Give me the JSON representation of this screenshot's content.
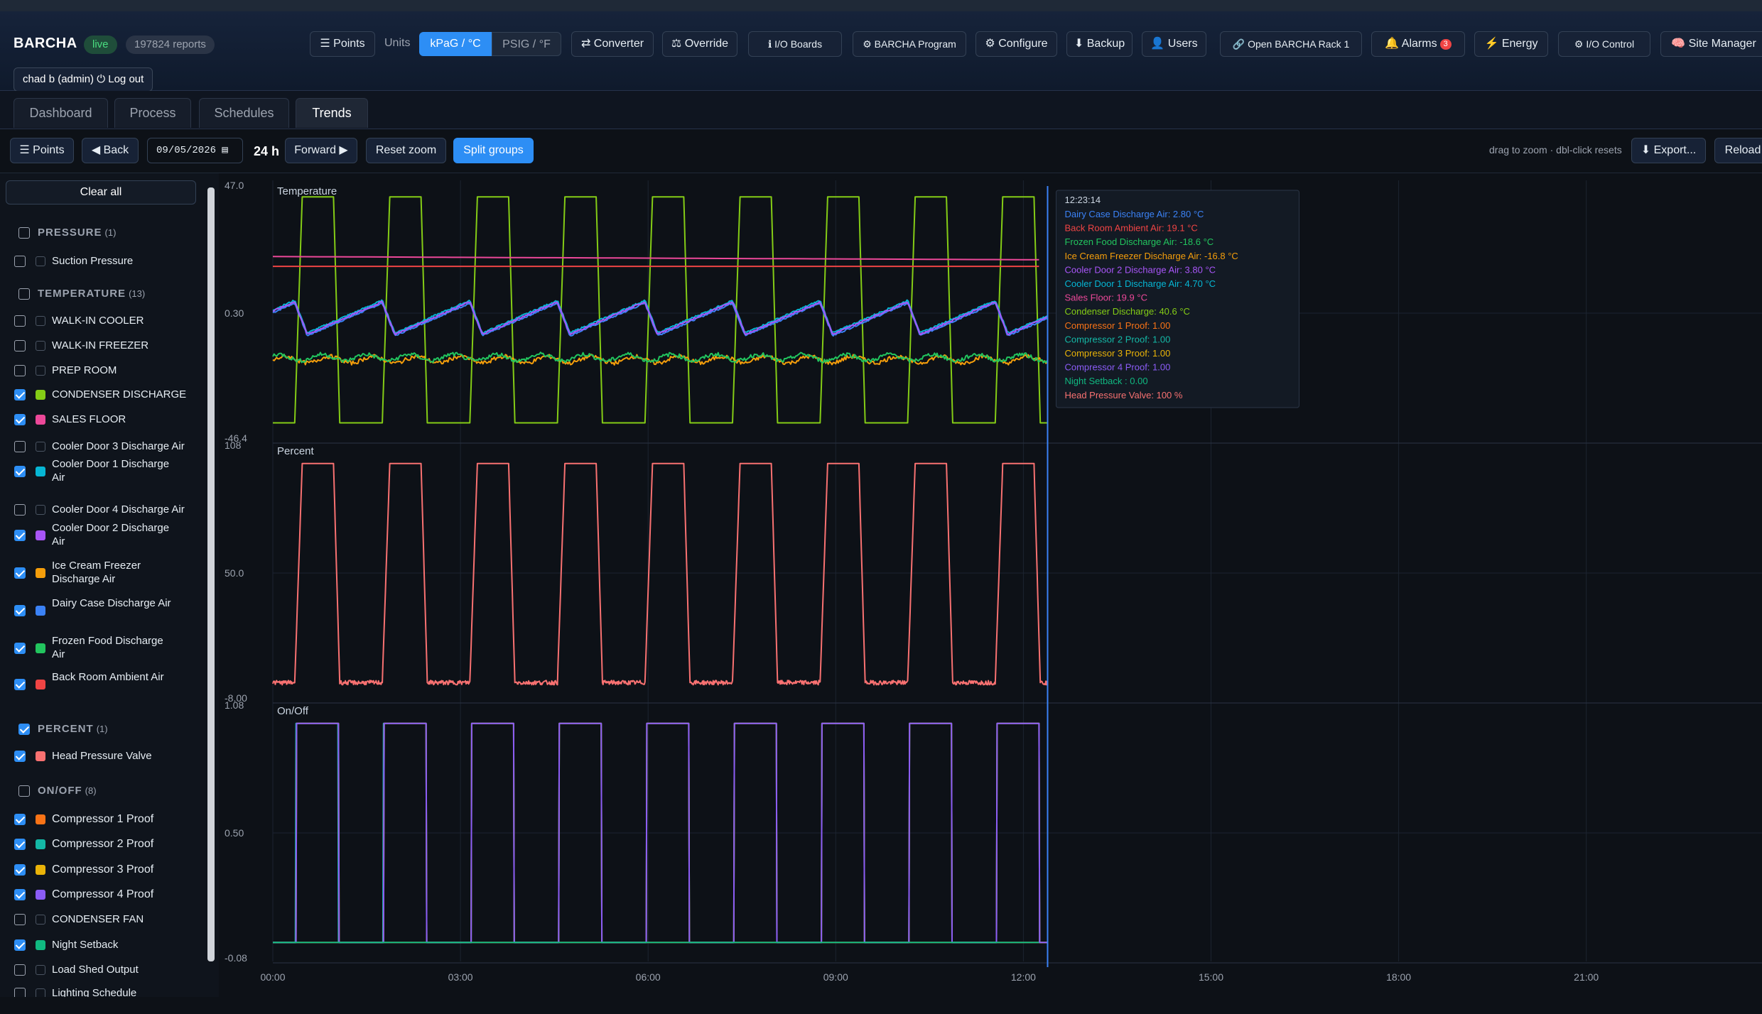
{
  "app": {
    "title": "BARCHA",
    "status": "live",
    "reports": "197824 reports",
    "user": "chad b (admin) ⏻ Log out"
  },
  "header": {
    "units_label": "Units",
    "units": [
      "kPaG / °C",
      "PSIG / °F"
    ],
    "buttons": [
      "☰ Points",
      "⇄ Converter",
      "⚖ Override",
      "ℹ I/O Boards",
      "⚙ BARCHA Program",
      "⚙ Configure",
      "⬇ Backup",
      "👤 Users",
      "🔗 Open BARCHA Rack 1",
      "🔔 Alarms",
      "⚡ Energy",
      "⚙ I/O Control",
      "🧠 Site Manager"
    ],
    "alarm_count": "3"
  },
  "tabs": [
    "Dashboard",
    "Process",
    "Schedules",
    "Trends"
  ],
  "toolbar": {
    "points": "☰ Points",
    "back": "◀ Back",
    "date": "09/05/2026 ▤",
    "span": "24 h",
    "forward": "Forward ▶",
    "reset": "Reset zoom",
    "split": "Split groups",
    "hint": "drag to zoom · dbl-click resets",
    "export": "⬇ Export...",
    "reload": "Reload"
  },
  "sidebar": {
    "clear_all": "Clear all",
    "groups": [
      {
        "name": "PRESSURE",
        "count": "(1)",
        "checked": false,
        "items": [
          {
            "label": "Suction Pressure",
            "checked": false,
            "color": ""
          }
        ]
      },
      {
        "name": "TEMPERATURE",
        "count": "(13)",
        "checked": false,
        "items": [
          {
            "label": "WALK-IN COOLER",
            "checked": false,
            "color": ""
          },
          {
            "label": "WALK-IN FREEZER",
            "checked": false,
            "color": ""
          },
          {
            "label": "PREP ROOM",
            "checked": false,
            "color": ""
          },
          {
            "label": "CONDENSER DISCHARGE",
            "checked": true,
            "color": "#84cc16"
          },
          {
            "label": "SALES FLOOR",
            "checked": true,
            "color": "#ec4899"
          },
          {
            "label": "Cooler Door 3 Discharge Air",
            "checked": false,
            "color": ""
          },
          {
            "label": "Cooler Door 1 Discharge Air",
            "checked": true,
            "color": "#06b6d4"
          },
          {
            "label": "Cooler Door 4 Discharge Air",
            "checked": false,
            "color": ""
          },
          {
            "label": "Cooler Door 2 Discharge Air",
            "checked": true,
            "color": "#a855f7"
          },
          {
            "label": "Ice Cream Freezer Discharge Air",
            "checked": true,
            "color": "#f59e0b"
          },
          {
            "label": "Dairy Case Discharge Air",
            "checked": true,
            "color": "#3b82f6"
          },
          {
            "label": "Frozen Food Discharge Air",
            "checked": true,
            "color": "#22c55e"
          },
          {
            "label": "Back Room Ambient Air",
            "checked": true,
            "color": "#ef4444"
          }
        ]
      },
      {
        "name": "PERCENT",
        "count": "(1)",
        "checked": true,
        "items": [
          {
            "label": "Head Pressure Valve",
            "checked": true,
            "color": "#f87171"
          }
        ]
      },
      {
        "name": "ON/OFF",
        "count": "(8)",
        "checked": false,
        "items": [
          {
            "label": "Compressor 1 Proof",
            "checked": true,
            "color": "#f97316"
          },
          {
            "label": "Compressor 2 Proof",
            "checked": true,
            "color": "#14b8a6"
          },
          {
            "label": "Compressor 3 Proof",
            "checked": true,
            "color": "#eab308"
          },
          {
            "label": "Compressor 4 Proof",
            "checked": true,
            "color": "#8b5cf6"
          },
          {
            "label": "CONDENSER FAN",
            "checked": false,
            "color": ""
          },
          {
            "label": "Night Setback",
            "checked": true,
            "color": "#10b981"
          },
          {
            "label": "Load Shed Output",
            "checked": false,
            "color": ""
          },
          {
            "label": "Lighting Schedule",
            "checked": false,
            "color": ""
          }
        ]
      }
    ]
  },
  "chart_data": {
    "type": "line",
    "x_ticks": [
      "00:00",
      "03:00",
      "06:00",
      "09:00",
      "12:00",
      "15:00",
      "18:00",
      "21:00"
    ],
    "xlim_hours": [
      0,
      24
    ],
    "cursor_time": "12:23:14",
    "panels": [
      {
        "title": "Temperature",
        "ylim": [
          -46.4,
          47.0
        ],
        "y_ticks": [
          "47.0",
          "0.30",
          "-46.4"
        ]
      },
      {
        "title": "Percent",
        "ylim": [
          -8.0,
          108
        ],
        "y_ticks": [
          "108",
          "50.0",
          "-8.00"
        ]
      },
      {
        "title": "On/Off",
        "ylim": [
          -0.08,
          1.08
        ],
        "y_ticks": [
          "1.08",
          "0.50",
          "-0.08"
        ]
      }
    ],
    "cycle_hours": 1.4,
    "series": [
      {
        "name": "Condenser Discharge",
        "panel": 0,
        "color": "#84cc16",
        "type": "square",
        "low": -40.0,
        "high": 43.0
      },
      {
        "name": "Sales Floor",
        "panel": 0,
        "color": "#ec4899",
        "type": "flat",
        "value": 19.9
      },
      {
        "name": "Back Room Ambient Air",
        "panel": 0,
        "color": "#ef4444",
        "type": "flat",
        "value": 17.5
      },
      {
        "name": "Dairy Case Discharge Air",
        "panel": 0,
        "color": "#3b82f6",
        "type": "saw",
        "low": -8.0,
        "high": 4.0
      },
      {
        "name": "Cooler Door 1 Discharge Air",
        "panel": 0,
        "color": "#06b6d4",
        "type": "saw",
        "low": -7.0,
        "high": 5.0
      },
      {
        "name": "Cooler Door 2 Discharge Air",
        "panel": 0,
        "color": "#a855f7",
        "type": "saw",
        "low": -7.5,
        "high": 4.5
      },
      {
        "name": "Ice Cream Freezer Discharge Air",
        "panel": 0,
        "color": "#f59e0b",
        "type": "noise",
        "value": -16.8
      },
      {
        "name": "Frozen Food Discharge Air",
        "panel": 0,
        "color": "#22c55e",
        "type": "noise",
        "value": -16.0
      },
      {
        "name": "Head Pressure Valve",
        "panel": 1,
        "color": "#f87171",
        "type": "square",
        "low": 0,
        "high": 100
      },
      {
        "name": "Compressor 1 Proof",
        "panel": 2,
        "color": "#f97316",
        "type": "square",
        "low": 0,
        "high": 1
      },
      {
        "name": "Compressor 2 Proof",
        "panel": 2,
        "color": "#14b8a6",
        "type": "square",
        "low": 0,
        "high": 1
      },
      {
        "name": "Compressor 3 Proof",
        "panel": 2,
        "color": "#eab308",
        "type": "square",
        "low": 0,
        "high": 1
      },
      {
        "name": "Compressor 4 Proof",
        "panel": 2,
        "color": "#8b5cf6",
        "type": "square",
        "low": 0,
        "high": 1
      },
      {
        "name": "Night Setback",
        "panel": 2,
        "color": "#10b981",
        "type": "flat",
        "value": 0
      }
    ],
    "tooltip": [
      {
        "text": "Dairy Case Discharge Air: 2.80 °C",
        "color": "#3b82f6"
      },
      {
        "text": "Back Room Ambient Air: 19.1 °C",
        "color": "#ef4444"
      },
      {
        "text": "Frozen Food Discharge Air: -18.6 °C",
        "color": "#22c55e"
      },
      {
        "text": "Ice Cream Freezer Discharge Air: -16.8 °C",
        "color": "#f59e0b"
      },
      {
        "text": "Cooler Door 2 Discharge Air: 3.80 °C",
        "color": "#a855f7"
      },
      {
        "text": "Cooler Door 1 Discharge Air: 4.70 °C",
        "color": "#06b6d4"
      },
      {
        "text": "Sales Floor: 19.9 °C",
        "color": "#ec4899"
      },
      {
        "text": "Condenser Discharge: 40.6 °C",
        "color": "#84cc16"
      },
      {
        "text": "Compressor 1 Proof: 1.00",
        "color": "#f97316"
      },
      {
        "text": "Compressor 2 Proof: 1.00",
        "color": "#14b8a6"
      },
      {
        "text": "Compressor 3 Proof: 1.00",
        "color": "#eab308"
      },
      {
        "text": "Compressor 4 Proof: 1.00",
        "color": "#8b5cf6"
      },
      {
        "text": "Night Setback : 0.00",
        "color": "#10b981"
      },
      {
        "text": "Head Pressure Valve: 100 %",
        "color": "#f87171"
      }
    ]
  }
}
